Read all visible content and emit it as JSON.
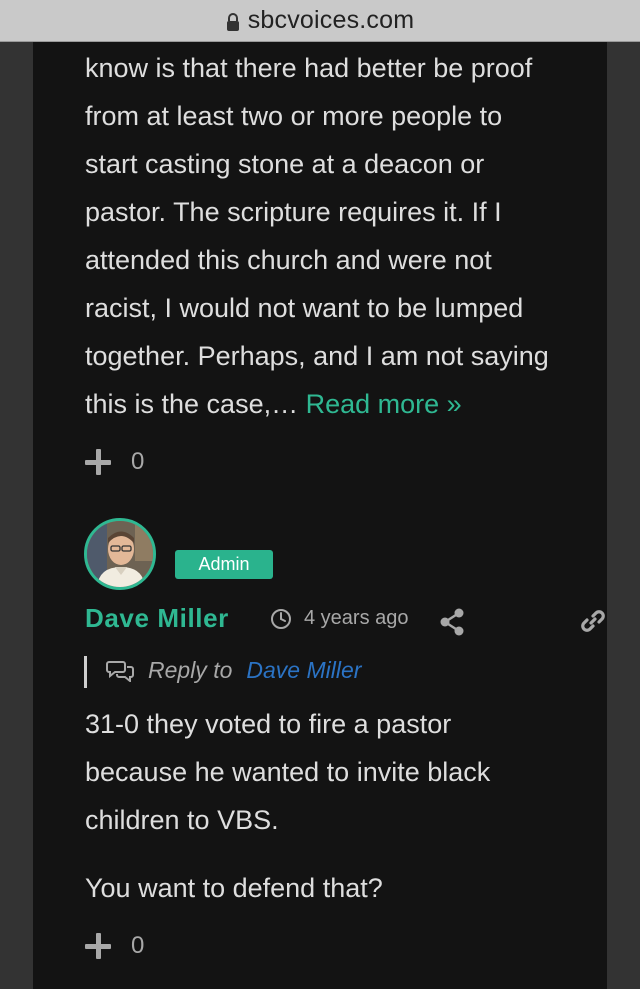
{
  "browser": {
    "domain": "sbcvoices.com"
  },
  "comment1": {
    "lines": [
      "know is that there had better be proof",
      "from at least two or more people to",
      "start casting stone at a deacon or",
      "pastor. The scripture requires it. If I",
      "attended this church and were not",
      "racist, I would not want to be lumped",
      "together. Perhaps, and I am not saying"
    ],
    "last_line": "this is the case,… ",
    "read_more": "Read more »",
    "vote_count": "0"
  },
  "comment2": {
    "badge": "Admin",
    "author": "Dave Miller",
    "time": "4 years ago",
    "reply_label": "Reply to",
    "reply_to": "Dave Miller",
    "paragraph1_lines": [
      "31-0 they voted to fire a pastor",
      "because he wanted to invite black",
      "children to VBS."
    ],
    "paragraph2": "You want to defend that?",
    "vote_count": "0"
  },
  "colors": {
    "accent": "#2fb892",
    "link_blue": "#2b73c4",
    "card_bg": "#131313",
    "page_bg": "#333333"
  },
  "icons": {
    "lock": "lock-icon",
    "plus": "plus-icon",
    "clock": "clock-icon",
    "share": "share-icon",
    "link": "link-icon",
    "reply": "chat-bubbles-icon"
  }
}
